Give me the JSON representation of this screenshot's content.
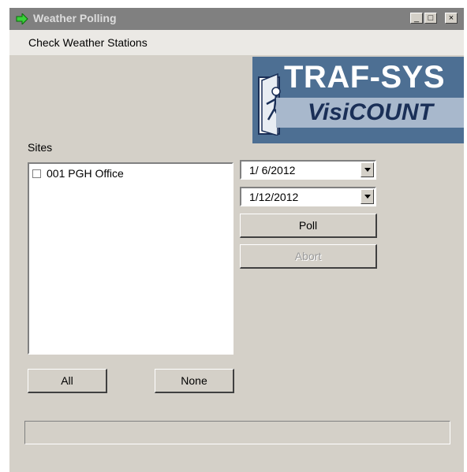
{
  "window": {
    "title": "Weather Polling",
    "controls": {
      "minimize": "_",
      "maximize": "□",
      "close": "×"
    }
  },
  "menu": {
    "items": [
      "Check Weather Stations"
    ]
  },
  "logo": {
    "brand": "TRAF-SYS",
    "product": "VisiCOUNT"
  },
  "sites": {
    "label": "Sites",
    "items": [
      {
        "label": "001 PGH Office",
        "checked": false
      }
    ]
  },
  "dates": {
    "start": "1/ 6/2012",
    "end": "1/12/2012"
  },
  "buttons": {
    "poll": "Poll",
    "abort": "Abort",
    "all": "All",
    "none": "None"
  },
  "status": {
    "text": ""
  }
}
